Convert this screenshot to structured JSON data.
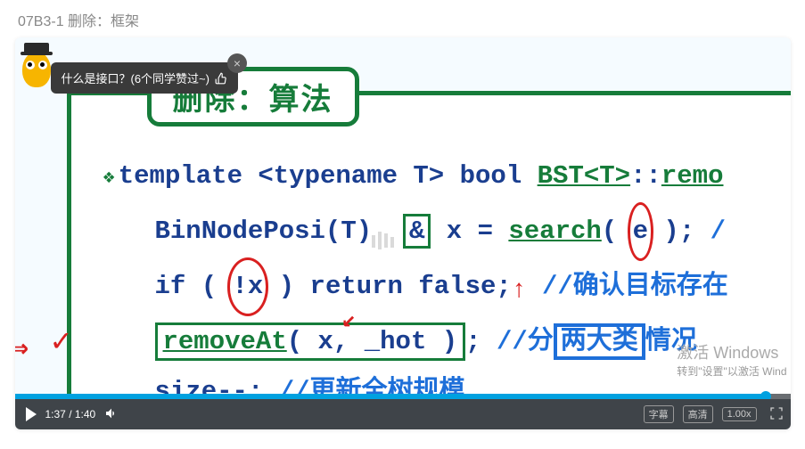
{
  "page_title": "07B3-1 删除：框架",
  "bubble": {
    "text": "什么是接口？(6个同学赞过~)"
  },
  "slide": {
    "title": "删除：算法",
    "lines": {
      "l1_pre": "template <typename T> bool ",
      "l1_fn": "BST<T>",
      "l1_mid": "::",
      "l1_fn2": "remo",
      "l2_pre": "BinNodePosi(T)",
      "l2_amp": "&",
      "l2_mid": "  x = ",
      "l2_fn": "search",
      "l2_p1": "( ",
      "l2_e": "e",
      "l2_p2": " );",
      "l2_com": "  /",
      "l3_pre": "if ( ",
      "l3_bang": "!x",
      "l3_mid": " ) return false;",
      "l3_com": "  //确认目标存在",
      "l4_fn": "removeAt",
      "l4_args": "( x, _hot )",
      "l4_semi": ";",
      "l4_com_pre": "  //分",
      "l4_box": "两大类",
      "l4_com_post": "情况",
      "l5_pre": "size--;",
      "l5_com": "  //更新全树规模"
    }
  },
  "watermark": {
    "line1": "激活 Windows",
    "line2": "转到\"设置\"以激活 Wind"
  },
  "controls": {
    "current": "1:37",
    "duration": "1:40",
    "subtitle": "字幕",
    "quality": "高清",
    "speed": "1.00x"
  }
}
